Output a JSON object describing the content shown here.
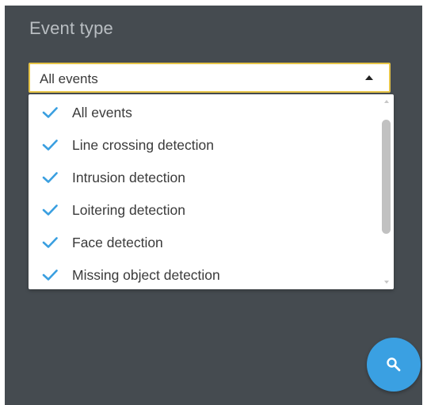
{
  "filter": {
    "title": "Event type",
    "selected_value": "All events"
  },
  "options": [
    {
      "label": "All events",
      "checked": true
    },
    {
      "label": "Line crossing detection",
      "checked": true
    },
    {
      "label": "Intrusion detection",
      "checked": true
    },
    {
      "label": "Loitering detection",
      "checked": true
    },
    {
      "label": "Face detection",
      "checked": true
    },
    {
      "label": "Missing object detection",
      "checked": true
    }
  ],
  "icons": {
    "check": "check-icon",
    "dropdown_arrow": "caret-up-icon",
    "search": "search-icon"
  },
  "colors": {
    "panel_bg": "#454b50",
    "accent_border": "#e6c447",
    "check": "#3a9fe0",
    "fab": "#3aa0e2"
  }
}
